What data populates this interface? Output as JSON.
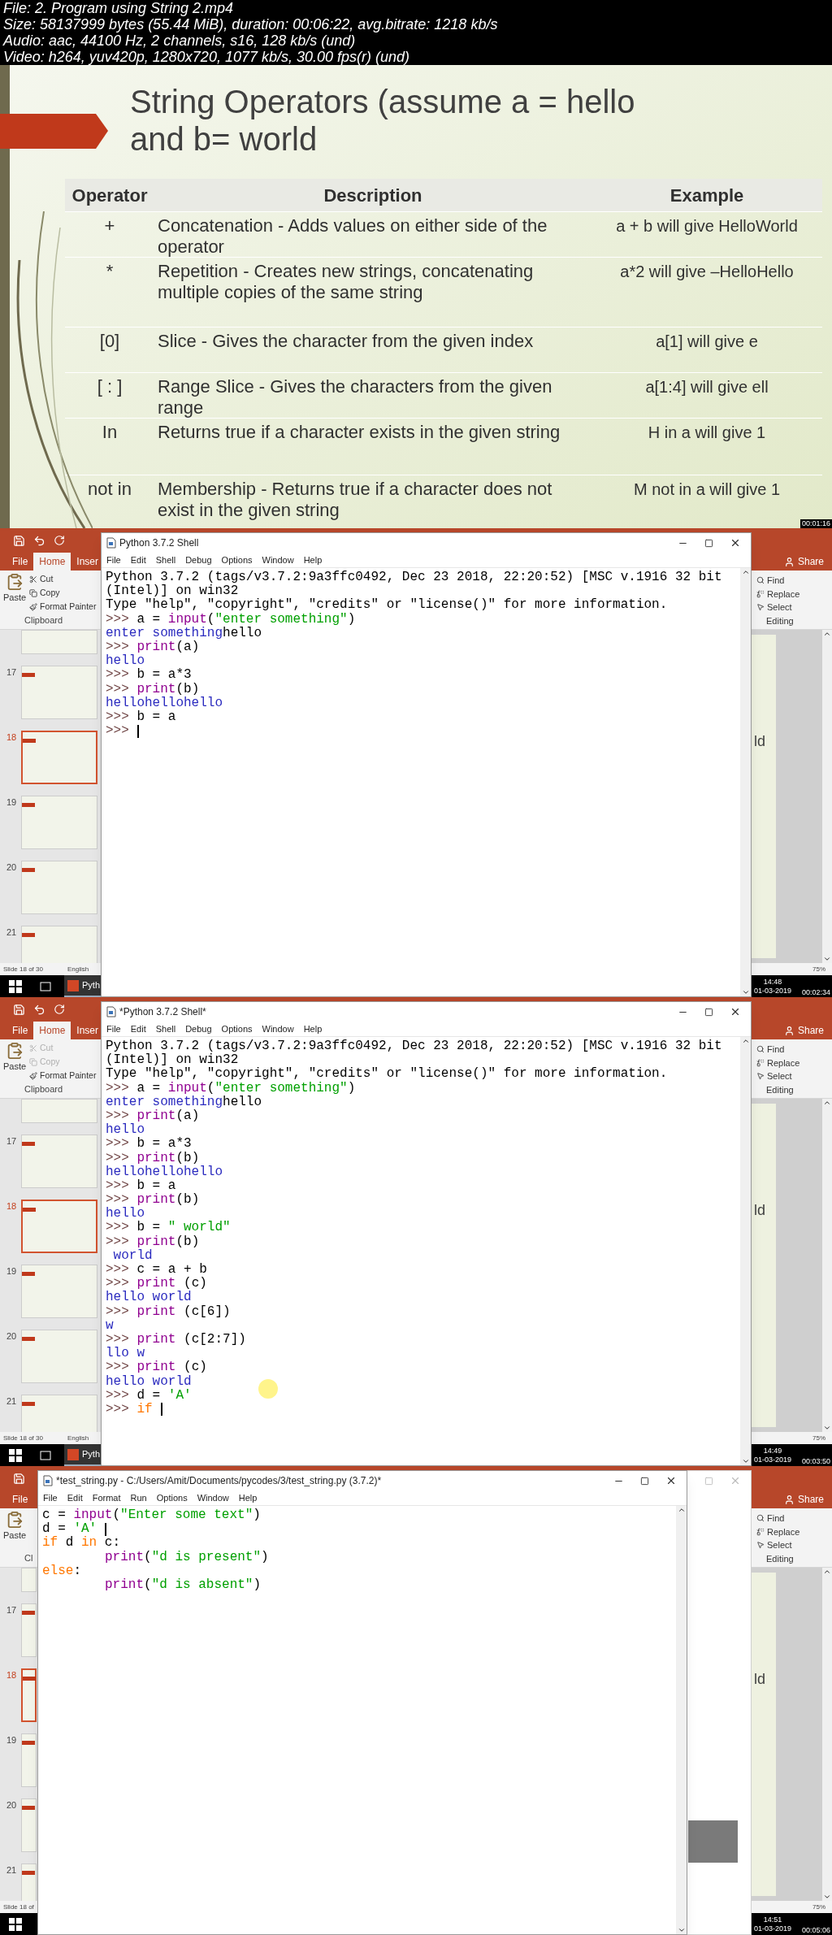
{
  "header": {
    "lines": [
      "File: 2. Program using String 2.mp4",
      "Size: 58137999 bytes (55.44 MiB), duration: 00:06:22, avg.bitrate: 1218 kb/s",
      "Audio: aac, 44100 Hz, 2 channels, s16, 128 kb/s (und)",
      "Video: h264, yuv420p, 1280x720, 1077 kb/s, 30.00 fps(r) (und)"
    ]
  },
  "frames": [
    {
      "kind": "slide",
      "timestamp": "00:01:16",
      "slide": {
        "title_lines": [
          "String Operators (assume a = hello",
          "and b= world"
        ],
        "table": {
          "columns": [
            "Operator",
            "Description",
            "Example"
          ],
          "rows": [
            {
              "operator": "+",
              "description": "Concatenation - Adds values on either side of the operator",
              "example": "a + b will give HelloWorld"
            },
            {
              "operator": "*",
              "description": "Repetition - Creates new strings, concatenating multiple copies of the same string",
              "example": "a*2 will give –HelloHello"
            },
            {
              "operator": "[0]",
              "description": "Slice - Gives the character from the given index",
              "example": "a[1] will give e"
            },
            {
              "operator": "[ : ]",
              "description": "Range Slice - Gives the characters from the given range",
              "example": "a[1:4] will give ell"
            },
            {
              "operator": "In",
              "description": "Returns true if a character exists in the given string",
              "example": "H in a will give 1"
            },
            {
              "operator": "not in",
              "description": "Membership - Returns true if a character does not exist in the given string",
              "example": "M not in a will give 1"
            }
          ]
        }
      }
    },
    {
      "kind": "desktop",
      "timestamp": "00:02:34",
      "powerpoint": {
        "tabs": [
          {
            "label": "File",
            "selected": false
          },
          {
            "label": "Home",
            "selected": true
          },
          {
            "label": "Inser",
            "selected": false
          }
        ],
        "share": "Share",
        "paste": "Paste",
        "clipboard_items": [
          {
            "label": "Cut",
            "disabled": false
          },
          {
            "label": "Copy",
            "disabled": false
          },
          {
            "label": "Format Painter",
            "disabled": false
          }
        ],
        "clipboard_group": "Clipboard",
        "editing_items": [
          "Find",
          "Replace",
          "Select"
        ],
        "editing_group": "Editing",
        "slide_numbers": [
          {
            "label": "17",
            "selected": false
          },
          {
            "label": "18",
            "selected": true
          },
          {
            "label": "19",
            "selected": false
          },
          {
            "label": "20",
            "selected": false
          },
          {
            "label": "21",
            "selected": false
          }
        ],
        "slide_fragment": "ld",
        "status": [
          "Slide 18 of 30",
          "English"
        ],
        "zoom": "75%",
        "taskbar_app": "Pyth",
        "clock": {
          "time": "14:48",
          "date": "01-03-2019"
        }
      },
      "window": {
        "kind": "shell",
        "title": "Python 3.7.2 Shell",
        "menu": [
          "File",
          "Edit",
          "Shell",
          "Debug",
          "Options",
          "Window",
          "Help"
        ],
        "lines": [
          {
            "segments": [
              {
                "kind": "plain",
                "text": "Python 3.7.2 (tags/v3.7.2:9a3ffc0492, Dec 23 2018, 22:20:52) [MSC v.1916 32 bit"
              }
            ]
          },
          {
            "segments": [
              {
                "kind": "plain",
                "text": "(Intel)] on win32"
              }
            ]
          },
          {
            "segments": [
              {
                "kind": "plain",
                "text": "Type \"help\", \"copyright\", \"credits\" or \"license()\" for more information."
              }
            ]
          },
          {
            "segments": [
              {
                "kind": "prompt",
                "text": ">>> "
              },
              {
                "kind": "plain",
                "text": "a = "
              },
              {
                "kind": "builtin",
                "text": "input"
              },
              {
                "kind": "plain",
                "text": "("
              },
              {
                "kind": "string",
                "text": "\"enter something\""
              },
              {
                "kind": "plain",
                "text": ")"
              }
            ]
          },
          {
            "segments": [
              {
                "kind": "output",
                "text": "enter something"
              },
              {
                "kind": "plain",
                "text": "hello"
              }
            ]
          },
          {
            "segments": [
              {
                "kind": "prompt",
                "text": ">>> "
              },
              {
                "kind": "builtin",
                "text": "print"
              },
              {
                "kind": "plain",
                "text": "(a)"
              }
            ]
          },
          {
            "segments": [
              {
                "kind": "output",
                "text": "hello"
              }
            ]
          },
          {
            "segments": [
              {
                "kind": "prompt",
                "text": ">>> "
              },
              {
                "kind": "plain",
                "text": "b = a*3"
              }
            ]
          },
          {
            "segments": [
              {
                "kind": "prompt",
                "text": ">>> "
              },
              {
                "kind": "builtin",
                "text": "print"
              },
              {
                "kind": "plain",
                "text": "(b)"
              }
            ]
          },
          {
            "segments": [
              {
                "kind": "output",
                "text": "hellohellohello"
              }
            ]
          },
          {
            "segments": [
              {
                "kind": "prompt",
                "text": ">>> "
              },
              {
                "kind": "plain",
                "text": "b = a"
              }
            ]
          },
          {
            "segments": [
              {
                "kind": "prompt",
                "text": ">>>"
              }
            ],
            "cursor": true
          }
        ]
      }
    },
    {
      "kind": "desktop",
      "timestamp": "00:03:50",
      "powerpoint": {
        "tabs": [
          {
            "label": "File",
            "selected": false
          },
          {
            "label": "Home",
            "selected": true
          },
          {
            "label": "Inser",
            "selected": false
          }
        ],
        "share": "Share",
        "paste": "Paste",
        "clipboard_items": [
          {
            "label": "Cut",
            "disabled": true
          },
          {
            "label": "Copy",
            "disabled": true
          },
          {
            "label": "Format Painter",
            "disabled": false
          }
        ],
        "clipboard_group": "Clipboard",
        "editing_items": [
          "Find",
          "Replace",
          "Select"
        ],
        "editing_group": "Editing",
        "slide_numbers": [
          {
            "label": "17",
            "selected": false
          },
          {
            "label": "18",
            "selected": true
          },
          {
            "label": "19",
            "selected": false
          },
          {
            "label": "20",
            "selected": false
          },
          {
            "label": "21",
            "selected": false
          }
        ],
        "slide_fragment": "ld",
        "status": [
          "Slide 18 of 30",
          "English"
        ],
        "zoom": "75%",
        "taskbar_app": "Pyth",
        "clock": {
          "time": "14:49",
          "date": "01-03-2019"
        }
      },
      "window": {
        "kind": "shell",
        "title": "*Python 3.7.2 Shell*",
        "menu": [
          "File",
          "Edit",
          "Shell",
          "Debug",
          "Options",
          "Window",
          "Help"
        ],
        "lines": [
          {
            "segments": [
              {
                "kind": "plain",
                "text": "Python 3.7.2 (tags/v3.7.2:9a3ffc0492, Dec 23 2018, 22:20:52) [MSC v.1916 32 bit"
              }
            ]
          },
          {
            "segments": [
              {
                "kind": "plain",
                "text": "(Intel)] on win32"
              }
            ]
          },
          {
            "segments": [
              {
                "kind": "plain",
                "text": "Type \"help\", \"copyright\", \"credits\" or \"license()\" for more information."
              }
            ]
          },
          {
            "segments": [
              {
                "kind": "prompt",
                "text": ">>> "
              },
              {
                "kind": "plain",
                "text": "a = "
              },
              {
                "kind": "builtin",
                "text": "input"
              },
              {
                "kind": "plain",
                "text": "("
              },
              {
                "kind": "string",
                "text": "\"enter something\""
              },
              {
                "kind": "plain",
                "text": ")"
              }
            ]
          },
          {
            "segments": [
              {
                "kind": "output",
                "text": "enter something"
              },
              {
                "kind": "plain",
                "text": "hello"
              }
            ]
          },
          {
            "segments": [
              {
                "kind": "prompt",
                "text": ">>> "
              },
              {
                "kind": "builtin",
                "text": "print"
              },
              {
                "kind": "plain",
                "text": "(a)"
              }
            ]
          },
          {
            "segments": [
              {
                "kind": "output",
                "text": "hello"
              }
            ]
          },
          {
            "segments": [
              {
                "kind": "prompt",
                "text": ">>> "
              },
              {
                "kind": "plain",
                "text": "b = a*3"
              }
            ]
          },
          {
            "segments": [
              {
                "kind": "prompt",
                "text": ">>> "
              },
              {
                "kind": "builtin",
                "text": "print"
              },
              {
                "kind": "plain",
                "text": "(b)"
              }
            ]
          },
          {
            "segments": [
              {
                "kind": "output",
                "text": "hellohellohello"
              }
            ]
          },
          {
            "segments": [
              {
                "kind": "prompt",
                "text": ">>> "
              },
              {
                "kind": "plain",
                "text": "b = a"
              }
            ]
          },
          {
            "segments": [
              {
                "kind": "prompt",
                "text": ">>> "
              },
              {
                "kind": "builtin",
                "text": "print"
              },
              {
                "kind": "plain",
                "text": "(b)"
              }
            ]
          },
          {
            "segments": [
              {
                "kind": "output",
                "text": "hello"
              }
            ]
          },
          {
            "segments": [
              {
                "kind": "prompt",
                "text": ">>> "
              },
              {
                "kind": "plain",
                "text": "b = "
              },
              {
                "kind": "string",
                "text": "\" world\""
              }
            ]
          },
          {
            "segments": [
              {
                "kind": "prompt",
                "text": ">>> "
              },
              {
                "kind": "builtin",
                "text": "print"
              },
              {
                "kind": "plain",
                "text": "(b)"
              }
            ]
          },
          {
            "segments": [
              {
                "kind": "output",
                "text": " world"
              }
            ]
          },
          {
            "segments": [
              {
                "kind": "prompt",
                "text": ">>> "
              },
              {
                "kind": "plain",
                "text": "c = a + b"
              }
            ]
          },
          {
            "segments": [
              {
                "kind": "prompt",
                "text": ">>> "
              },
              {
                "kind": "builtin",
                "text": "print"
              },
              {
                "kind": "plain",
                "text": " (c)"
              }
            ]
          },
          {
            "segments": [
              {
                "kind": "output",
                "text": "hello world"
              }
            ]
          },
          {
            "segments": [
              {
                "kind": "prompt",
                "text": ">>> "
              },
              {
                "kind": "builtin",
                "text": "print"
              },
              {
                "kind": "plain",
                "text": " (c[6])"
              }
            ]
          },
          {
            "segments": [
              {
                "kind": "output",
                "text": "w"
              }
            ]
          },
          {
            "segments": [
              {
                "kind": "prompt",
                "text": ">>> "
              },
              {
                "kind": "builtin",
                "text": "print"
              },
              {
                "kind": "plain",
                "text": " (c[2:7])"
              }
            ]
          },
          {
            "segments": [
              {
                "kind": "output",
                "text": "llo w"
              }
            ]
          },
          {
            "segments": [
              {
                "kind": "prompt",
                "text": ">>> "
              },
              {
                "kind": "builtin",
                "text": "print"
              },
              {
                "kind": "plain",
                "text": " (c)"
              }
            ]
          },
          {
            "segments": [
              {
                "kind": "output",
                "text": "hello world"
              }
            ]
          },
          {
            "segments": [
              {
                "kind": "prompt",
                "text": ">>> "
              },
              {
                "kind": "plain",
                "text": "d = "
              },
              {
                "kind": "string",
                "text": "'A'"
              }
            ]
          },
          {
            "segments": [
              {
                "kind": "prompt",
                "text": ">>> "
              },
              {
                "kind": "keyword",
                "text": "if"
              }
            ],
            "cursor": true
          }
        ]
      }
    },
    {
      "kind": "desktop",
      "timestamp": "00:05:06",
      "powerpoint": {
        "tabs": [
          {
            "label": "File",
            "selected": false
          }
        ],
        "share": "Share",
        "paste": "Paste",
        "clipboard_group": "Cl",
        "editing_items": [
          "Find",
          "Replace",
          "Select"
        ],
        "editing_group": "Editing",
        "slide_numbers": [
          {
            "label": "17",
            "selected": false
          },
          {
            "label": "18",
            "selected": true
          },
          {
            "label": "19",
            "selected": false
          },
          {
            "label": "20",
            "selected": false
          },
          {
            "label": "21",
            "selected": false
          }
        ],
        "slide_fragment": "ld",
        "status": [
          "Slide 18 of"
        ],
        "zoom": "75%",
        "clock": {
          "time": "14:51",
          "date": "01-03-2019"
        }
      },
      "window": {
        "kind": "editor",
        "title": "*test_string.py - C:/Users/Amit/Documents/pycodes/3/test_string.py (3.7.2)*",
        "menu": [
          "File",
          "Edit",
          "Format",
          "Run",
          "Options",
          "Window",
          "Help"
        ],
        "lines": [
          {
            "segments": [
              {
                "kind": "plain",
                "text": "c = "
              },
              {
                "kind": "builtin",
                "text": "input"
              },
              {
                "kind": "plain",
                "text": "("
              },
              {
                "kind": "string",
                "text": "\"Enter some text\""
              },
              {
                "kind": "plain",
                "text": ")"
              }
            ]
          },
          {
            "segments": [
              {
                "kind": "plain",
                "text": "d = "
              },
              {
                "kind": "string",
                "text": "'A'"
              }
            ],
            "cursor": true
          },
          {
            "segments": [
              {
                "kind": "keyword",
                "text": "if"
              },
              {
                "kind": "plain",
                "text": " d "
              },
              {
                "kind": "keyword",
                "text": "in"
              },
              {
                "kind": "plain",
                "text": " c:"
              }
            ]
          },
          {
            "indent": true,
            "segments": [
              {
                "kind": "builtin",
                "text": "print"
              },
              {
                "kind": "plain",
                "text": "("
              },
              {
                "kind": "string",
                "text": "\"d is present\""
              },
              {
                "kind": "plain",
                "text": ")"
              }
            ]
          },
          {
            "segments": [
              {
                "kind": "keyword",
                "text": "else"
              },
              {
                "kind": "plain",
                "text": ":"
              }
            ]
          },
          {
            "indent": true,
            "segments": [
              {
                "kind": "builtin",
                "text": "print"
              },
              {
                "kind": "plain",
                "text": "("
              },
              {
                "kind": "string",
                "text": "\"d is absent\""
              },
              {
                "kind": "plain",
                "text": ")"
              }
            ]
          }
        ]
      }
    }
  ]
}
